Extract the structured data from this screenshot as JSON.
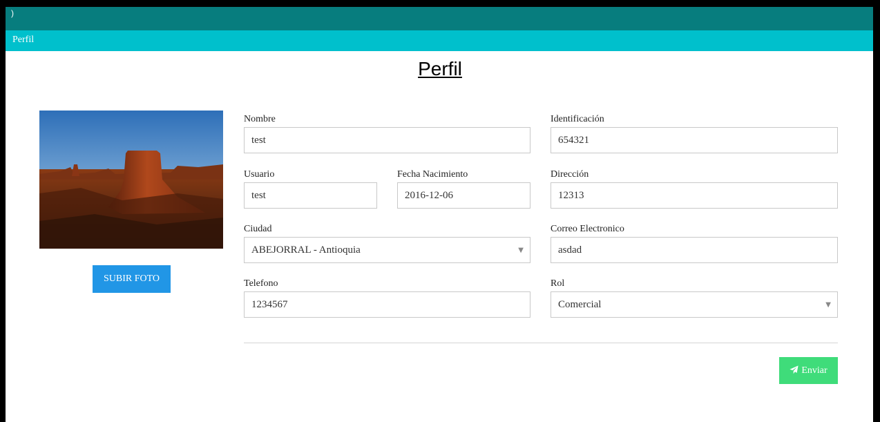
{
  "header": {
    "breadcrumb": "Perfil"
  },
  "page": {
    "title": "Perfil"
  },
  "profile": {
    "upload_label": "SUBIR FOTO"
  },
  "form": {
    "nombre": {
      "label": "Nombre",
      "value": "test"
    },
    "identificacion": {
      "label": "Identificación",
      "value": "654321"
    },
    "usuario": {
      "label": "Usuario",
      "value": "test"
    },
    "fecha_nacimiento": {
      "label": "Fecha Nacimiento",
      "value": "2016-12-06"
    },
    "direccion": {
      "label": "Dirección",
      "value": "12313"
    },
    "ciudad": {
      "label": "Ciudad",
      "value": "ABEJORRAL - Antioquia"
    },
    "correo": {
      "label": "Correo Electronico",
      "value": "asdad"
    },
    "telefono": {
      "label": "Telefono",
      "value": "1234567"
    },
    "rol": {
      "label": "Rol",
      "value": "Comercial"
    },
    "submit_label": "Enviar"
  },
  "colors": {
    "topbar": "#077d7e",
    "subbar": "#00c0cc",
    "upload_button": "#2196e6",
    "send_button": "#3fdc7a"
  },
  "icons": {
    "send": "paper-plane-icon",
    "select_caret": "caret-down-icon"
  }
}
